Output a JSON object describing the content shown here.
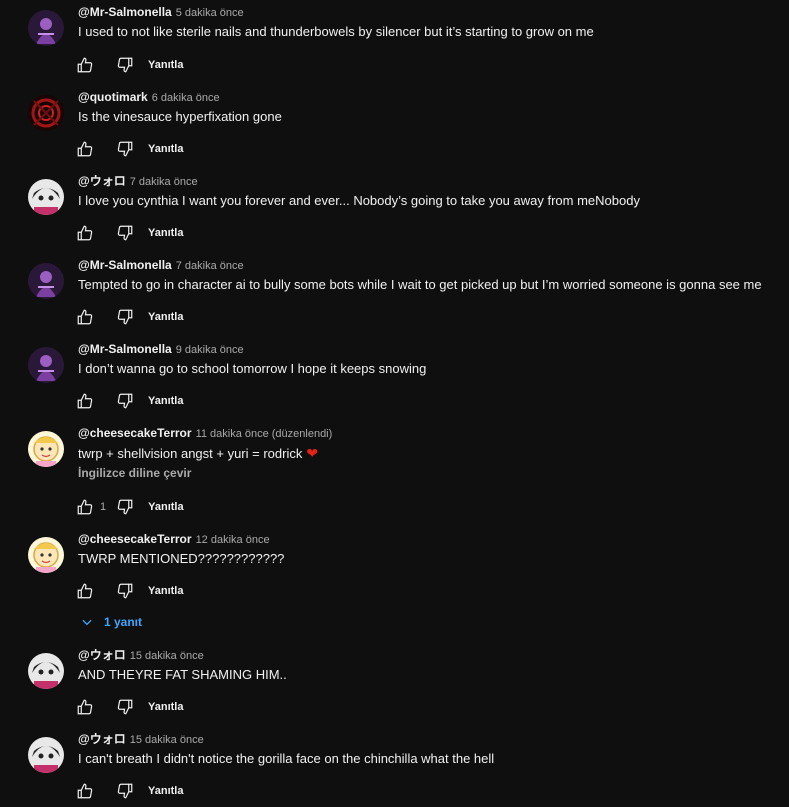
{
  "labels": {
    "reply": "Yanıtla",
    "translate": "İngilizce diline çevir"
  },
  "replies_toggle": {
    "label": "1 yanıt"
  },
  "comments": [
    {
      "author": "@Mr-Salmonella",
      "time": "5 dakika önce",
      "edited": "",
      "text": "I used to not like sterile nails and thunderbowels by silencer but it’s starting to grow on me",
      "likes": "",
      "avatar": "purple-figure"
    },
    {
      "author": "@quotimark",
      "time": "6 dakika önce",
      "edited": "",
      "text": "Is the vinesauce hyperfixation gone",
      "likes": "",
      "avatar": "red-pattern"
    },
    {
      "author": "@ウォロ",
      "time": "7 dakika önce",
      "edited": "",
      "text": "I love you cynthia I want you forever and ever... Nobody’s going to take you away from meNobody",
      "likes": "",
      "avatar": "anime-dark"
    },
    {
      "author": "@Mr-Salmonella",
      "time": "7 dakika önce",
      "edited": "",
      "text": "Tempted to go in character ai to bully some bots while I wait to get picked up but I’m worried someone is gonna see me",
      "likes": "",
      "avatar": "purple-figure"
    },
    {
      "author": "@Mr-Salmonella",
      "time": "9 dakika önce",
      "edited": "",
      "text": "I don’t wanna go to school tomorrow I hope it keeps snowing",
      "likes": "",
      "avatar": "purple-figure"
    },
    {
      "author": "@cheesecakeTerror",
      "time": "11 dakika önce",
      "edited": "(düzenlendi)",
      "text": "twrp + shellvision angst + yuri = rodrick",
      "likes": "1",
      "avatar": "cartoon-face"
    },
    {
      "author": "@cheesecakeTerror",
      "time": "12 dakika önce",
      "edited": "",
      "text": "TWRP MENTIONED????????????",
      "likes": "",
      "avatar": "cartoon-face"
    },
    {
      "author": "@ウォロ",
      "time": "15 dakika önce",
      "edited": "",
      "text": "AND THEYRE FAT SHAMING HIM..",
      "likes": "",
      "avatar": "anime-dark"
    },
    {
      "author": "@ウォロ",
      "time": "15 dakika önce",
      "edited": "",
      "text": "I can't breath I didn't notice the gorilla face on the chinchilla what the hell",
      "likes": "",
      "avatar": "anime-dark"
    }
  ]
}
